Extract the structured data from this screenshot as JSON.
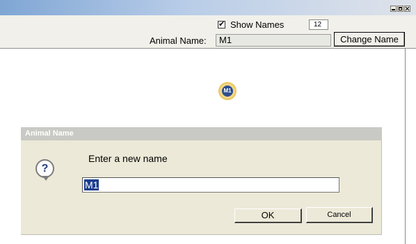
{
  "window": {
    "controls": [
      "minimize-icon",
      "maximize-icon",
      "close-icon"
    ]
  },
  "toolbar": {
    "show_names_checked": "✔",
    "show_names_label": "Show Names",
    "number_value": "12",
    "animal_name_label": "Animal Name:",
    "animal_name_value": "M1",
    "change_name_label": "Change Name"
  },
  "canvas": {
    "marker_label": "M1"
  },
  "dialog": {
    "title": "Animal Name",
    "prompt": "Enter a new name",
    "icon": "question-icon",
    "input_value": "M1",
    "ok_label": "OK",
    "cancel_label": "Cancel"
  },
  "colors": {
    "title_bar_start": "#7fa6d4",
    "marker_fill": "#2d4f8e",
    "marker_ring": "#f3d68a",
    "selection": "#1b3d8d"
  }
}
